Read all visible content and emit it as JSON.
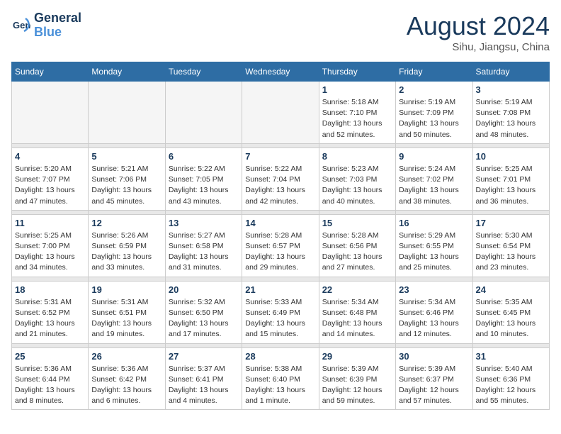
{
  "header": {
    "logo_line1": "General",
    "logo_line2": "Blue",
    "month_title": "August 2024",
    "location": "Sihu, Jiangsu, China"
  },
  "weekdays": [
    "Sunday",
    "Monday",
    "Tuesday",
    "Wednesday",
    "Thursday",
    "Friday",
    "Saturday"
  ],
  "weeks": [
    {
      "days": [
        {
          "num": "",
          "info": ""
        },
        {
          "num": "",
          "info": ""
        },
        {
          "num": "",
          "info": ""
        },
        {
          "num": "",
          "info": ""
        },
        {
          "num": "1",
          "info": "Sunrise: 5:18 AM\nSunset: 7:10 PM\nDaylight: 13 hours\nand 52 minutes."
        },
        {
          "num": "2",
          "info": "Sunrise: 5:19 AM\nSunset: 7:09 PM\nDaylight: 13 hours\nand 50 minutes."
        },
        {
          "num": "3",
          "info": "Sunrise: 5:19 AM\nSunset: 7:08 PM\nDaylight: 13 hours\nand 48 minutes."
        }
      ]
    },
    {
      "days": [
        {
          "num": "4",
          "info": "Sunrise: 5:20 AM\nSunset: 7:07 PM\nDaylight: 13 hours\nand 47 minutes."
        },
        {
          "num": "5",
          "info": "Sunrise: 5:21 AM\nSunset: 7:06 PM\nDaylight: 13 hours\nand 45 minutes."
        },
        {
          "num": "6",
          "info": "Sunrise: 5:22 AM\nSunset: 7:05 PM\nDaylight: 13 hours\nand 43 minutes."
        },
        {
          "num": "7",
          "info": "Sunrise: 5:22 AM\nSunset: 7:04 PM\nDaylight: 13 hours\nand 42 minutes."
        },
        {
          "num": "8",
          "info": "Sunrise: 5:23 AM\nSunset: 7:03 PM\nDaylight: 13 hours\nand 40 minutes."
        },
        {
          "num": "9",
          "info": "Sunrise: 5:24 AM\nSunset: 7:02 PM\nDaylight: 13 hours\nand 38 minutes."
        },
        {
          "num": "10",
          "info": "Sunrise: 5:25 AM\nSunset: 7:01 PM\nDaylight: 13 hours\nand 36 minutes."
        }
      ]
    },
    {
      "days": [
        {
          "num": "11",
          "info": "Sunrise: 5:25 AM\nSunset: 7:00 PM\nDaylight: 13 hours\nand 34 minutes."
        },
        {
          "num": "12",
          "info": "Sunrise: 5:26 AM\nSunset: 6:59 PM\nDaylight: 13 hours\nand 33 minutes."
        },
        {
          "num": "13",
          "info": "Sunrise: 5:27 AM\nSunset: 6:58 PM\nDaylight: 13 hours\nand 31 minutes."
        },
        {
          "num": "14",
          "info": "Sunrise: 5:28 AM\nSunset: 6:57 PM\nDaylight: 13 hours\nand 29 minutes."
        },
        {
          "num": "15",
          "info": "Sunrise: 5:28 AM\nSunset: 6:56 PM\nDaylight: 13 hours\nand 27 minutes."
        },
        {
          "num": "16",
          "info": "Sunrise: 5:29 AM\nSunset: 6:55 PM\nDaylight: 13 hours\nand 25 minutes."
        },
        {
          "num": "17",
          "info": "Sunrise: 5:30 AM\nSunset: 6:54 PM\nDaylight: 13 hours\nand 23 minutes."
        }
      ]
    },
    {
      "days": [
        {
          "num": "18",
          "info": "Sunrise: 5:31 AM\nSunset: 6:52 PM\nDaylight: 13 hours\nand 21 minutes."
        },
        {
          "num": "19",
          "info": "Sunrise: 5:31 AM\nSunset: 6:51 PM\nDaylight: 13 hours\nand 19 minutes."
        },
        {
          "num": "20",
          "info": "Sunrise: 5:32 AM\nSunset: 6:50 PM\nDaylight: 13 hours\nand 17 minutes."
        },
        {
          "num": "21",
          "info": "Sunrise: 5:33 AM\nSunset: 6:49 PM\nDaylight: 13 hours\nand 15 minutes."
        },
        {
          "num": "22",
          "info": "Sunrise: 5:34 AM\nSunset: 6:48 PM\nDaylight: 13 hours\nand 14 minutes."
        },
        {
          "num": "23",
          "info": "Sunrise: 5:34 AM\nSunset: 6:46 PM\nDaylight: 13 hours\nand 12 minutes."
        },
        {
          "num": "24",
          "info": "Sunrise: 5:35 AM\nSunset: 6:45 PM\nDaylight: 13 hours\nand 10 minutes."
        }
      ]
    },
    {
      "days": [
        {
          "num": "25",
          "info": "Sunrise: 5:36 AM\nSunset: 6:44 PM\nDaylight: 13 hours\nand 8 minutes."
        },
        {
          "num": "26",
          "info": "Sunrise: 5:36 AM\nSunset: 6:42 PM\nDaylight: 13 hours\nand 6 minutes."
        },
        {
          "num": "27",
          "info": "Sunrise: 5:37 AM\nSunset: 6:41 PM\nDaylight: 13 hours\nand 4 minutes."
        },
        {
          "num": "28",
          "info": "Sunrise: 5:38 AM\nSunset: 6:40 PM\nDaylight: 13 hours\nand 1 minute."
        },
        {
          "num": "29",
          "info": "Sunrise: 5:39 AM\nSunset: 6:39 PM\nDaylight: 12 hours\nand 59 minutes."
        },
        {
          "num": "30",
          "info": "Sunrise: 5:39 AM\nSunset: 6:37 PM\nDaylight: 12 hours\nand 57 minutes."
        },
        {
          "num": "31",
          "info": "Sunrise: 5:40 AM\nSunset: 6:36 PM\nDaylight: 12 hours\nand 55 minutes."
        }
      ]
    }
  ]
}
